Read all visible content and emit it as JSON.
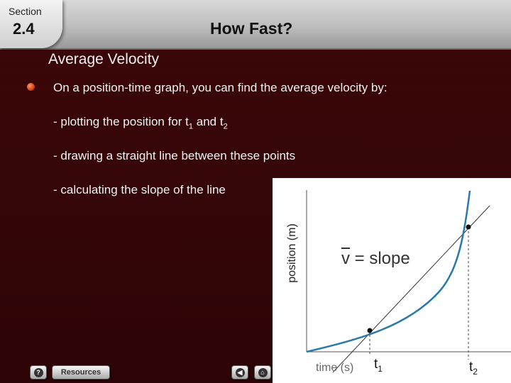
{
  "header": {
    "section_label": "Section",
    "section_number": "2.4",
    "title": "How Fast?"
  },
  "content": {
    "subtitle": "Average Velocity",
    "bullet": "On a position-time graph, you can find the average velocity  by:",
    "steps": [
      {
        "text": "- plotting the  position for t",
        "sub1": "1",
        "mid": " and t",
        "sub2": "2"
      },
      {
        "text": "- drawing a straight line between these points"
      },
      {
        "text": "- calculating the slope of the line"
      }
    ]
  },
  "figure": {
    "y_axis_label": "position (m)",
    "x_axis_label": "time (s)",
    "t1": {
      "base": "t",
      "sub": "1"
    },
    "t2": {
      "base": "t",
      "sub": "2"
    },
    "annotation": {
      "v": "v",
      "rest": " = slope"
    },
    "colors": {
      "curve": "#2a79aa",
      "line": "#333333",
      "axis": "#555555"
    }
  },
  "nav": {
    "help_icon": "question-icon",
    "resources_label": "Resources",
    "back_icon": "arrow-left-icon",
    "home_icon": "home-icon"
  }
}
